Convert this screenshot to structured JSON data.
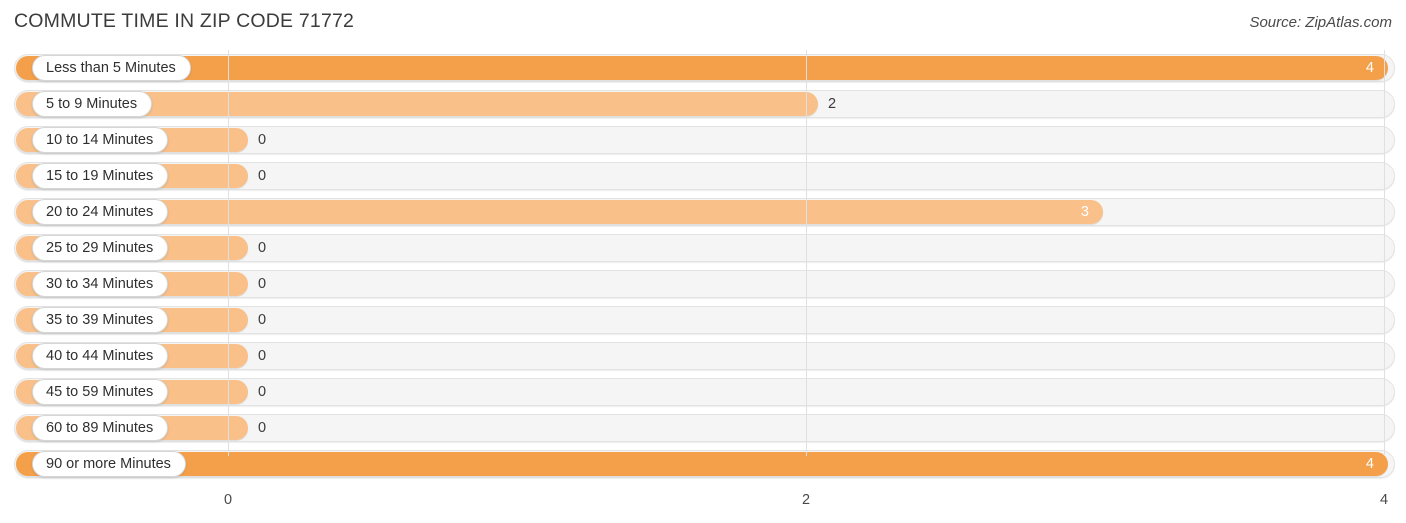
{
  "header": {
    "title": "COMMUTE TIME IN ZIP CODE 71772",
    "source": "Source: ZipAtlas.com"
  },
  "colors": {
    "bar_strong": "#f4a04b",
    "bar_light": "#f9c089",
    "track": "#f5f5f5",
    "gridline": "#e0e0e0",
    "text": "#3c3c3c"
  },
  "chart_data": {
    "type": "bar",
    "orientation": "horizontal",
    "title": "COMMUTE TIME IN ZIP CODE 71772",
    "xlabel": "",
    "ylabel": "",
    "xlim": [
      0,
      4
    ],
    "xticks": [
      0,
      2,
      4
    ],
    "xtick_labels": [
      "0",
      "2",
      "4"
    ],
    "grid": true,
    "legend": false,
    "categories": [
      "Less than 5 Minutes",
      "5 to 9 Minutes",
      "10 to 14 Minutes",
      "15 to 19 Minutes",
      "20 to 24 Minutes",
      "25 to 29 Minutes",
      "30 to 34 Minutes",
      "35 to 39 Minutes",
      "40 to 44 Minutes",
      "45 to 59 Minutes",
      "60 to 89 Minutes",
      "90 or more Minutes"
    ],
    "values": [
      4,
      2,
      0,
      0,
      3,
      0,
      0,
      0,
      0,
      0,
      0,
      4
    ],
    "value_labels": [
      "4",
      "2",
      "0",
      "0",
      "3",
      "0",
      "0",
      "0",
      "0",
      "0",
      "0",
      "4"
    ]
  }
}
